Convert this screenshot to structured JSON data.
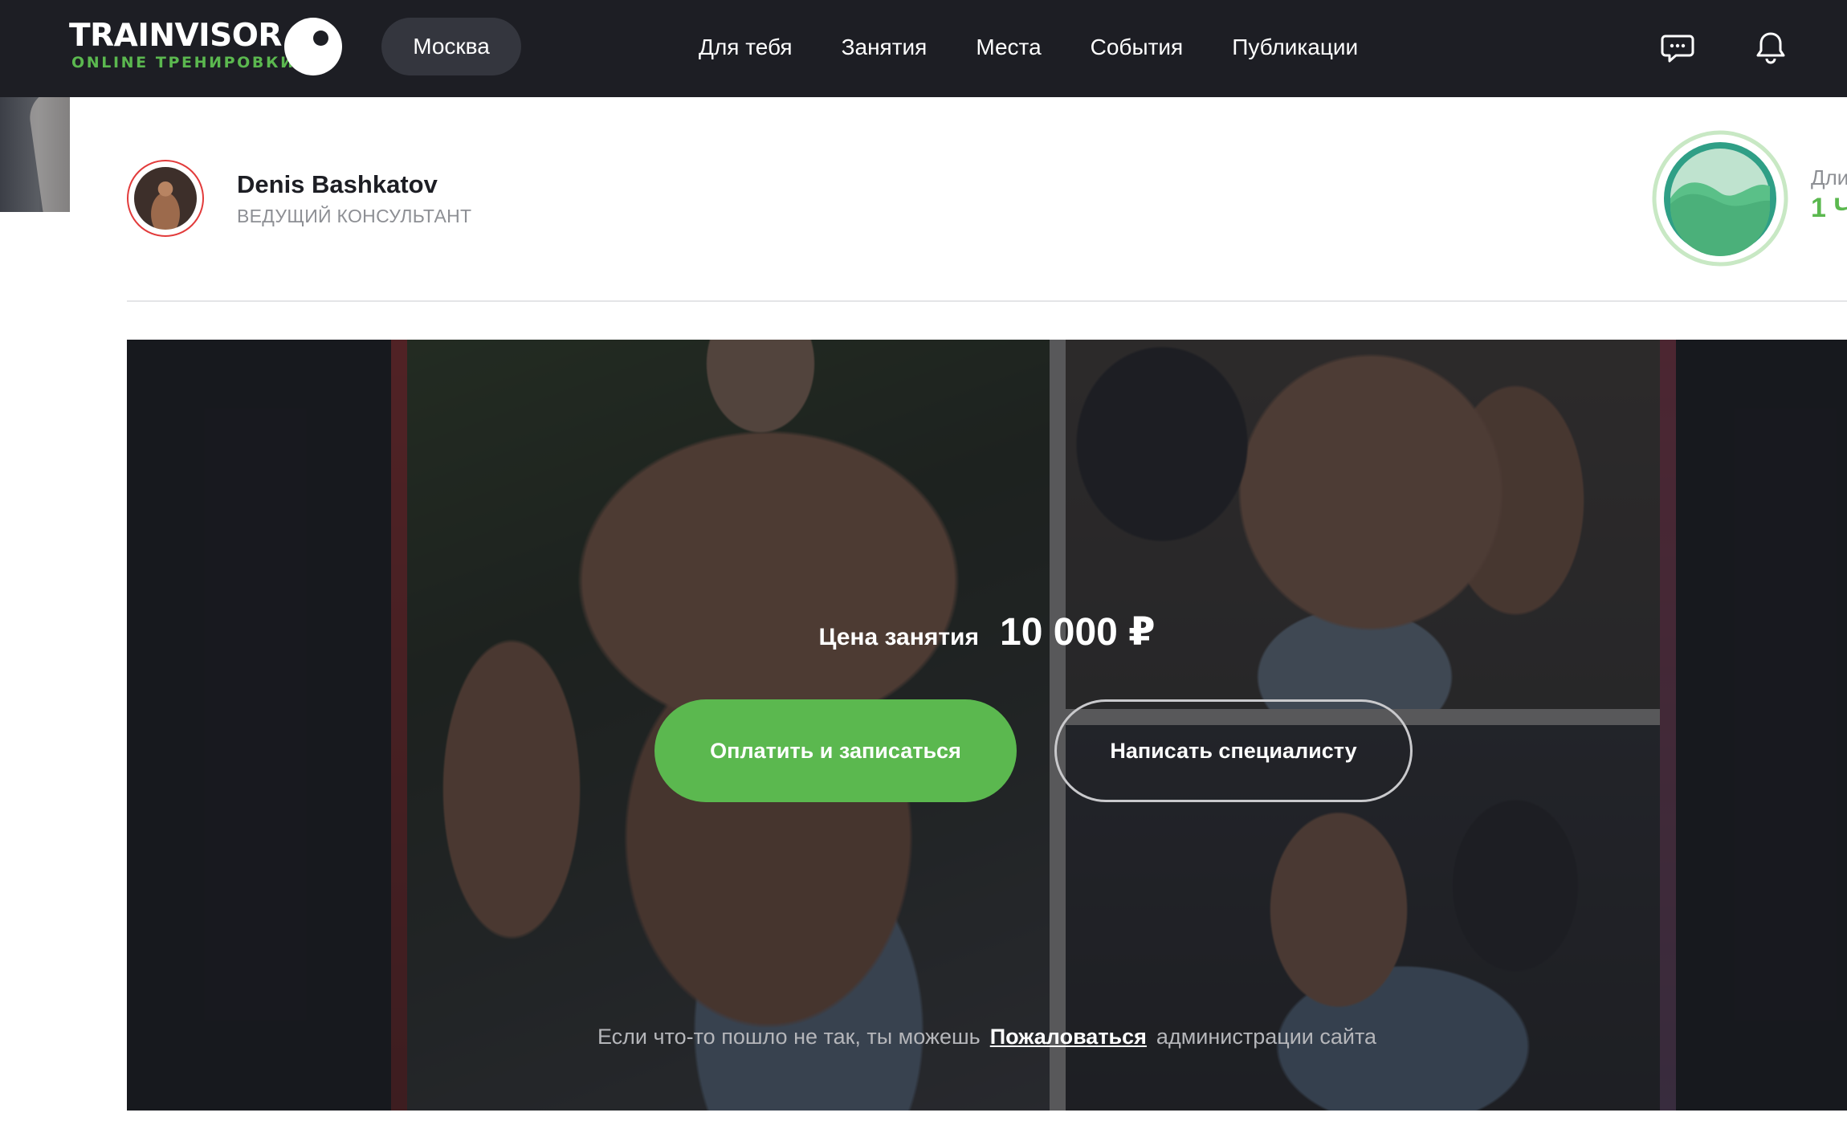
{
  "brand": {
    "name": "TRAINVISOR",
    "tagline": "ONLINE ТРЕНИРОВКИ",
    "accent": "#5bb84f",
    "dark": "#1d1e24"
  },
  "header": {
    "city": "Москва",
    "nav": [
      "Для тебя",
      "Занятия",
      "Места",
      "События",
      "Публикации"
    ],
    "icons": [
      "chat-icon",
      "bell-icon"
    ]
  },
  "trainer": {
    "name": "Denis Bashkatov",
    "role": "ВЕДУЩИЙ КОНСУЛЬТАНТ"
  },
  "duration": {
    "label": "Дли",
    "value": "1 Ч"
  },
  "offer": {
    "price_label": "Цена занятия",
    "price_value": "10 000 ₽",
    "pay_button": "Оплатить и записаться",
    "write_button": "Написать специалисту",
    "report_prefix": "Если что-то пошло не так, ты можешь",
    "report_link": "Пожаловаться",
    "report_suffix": "администрации сайта"
  }
}
